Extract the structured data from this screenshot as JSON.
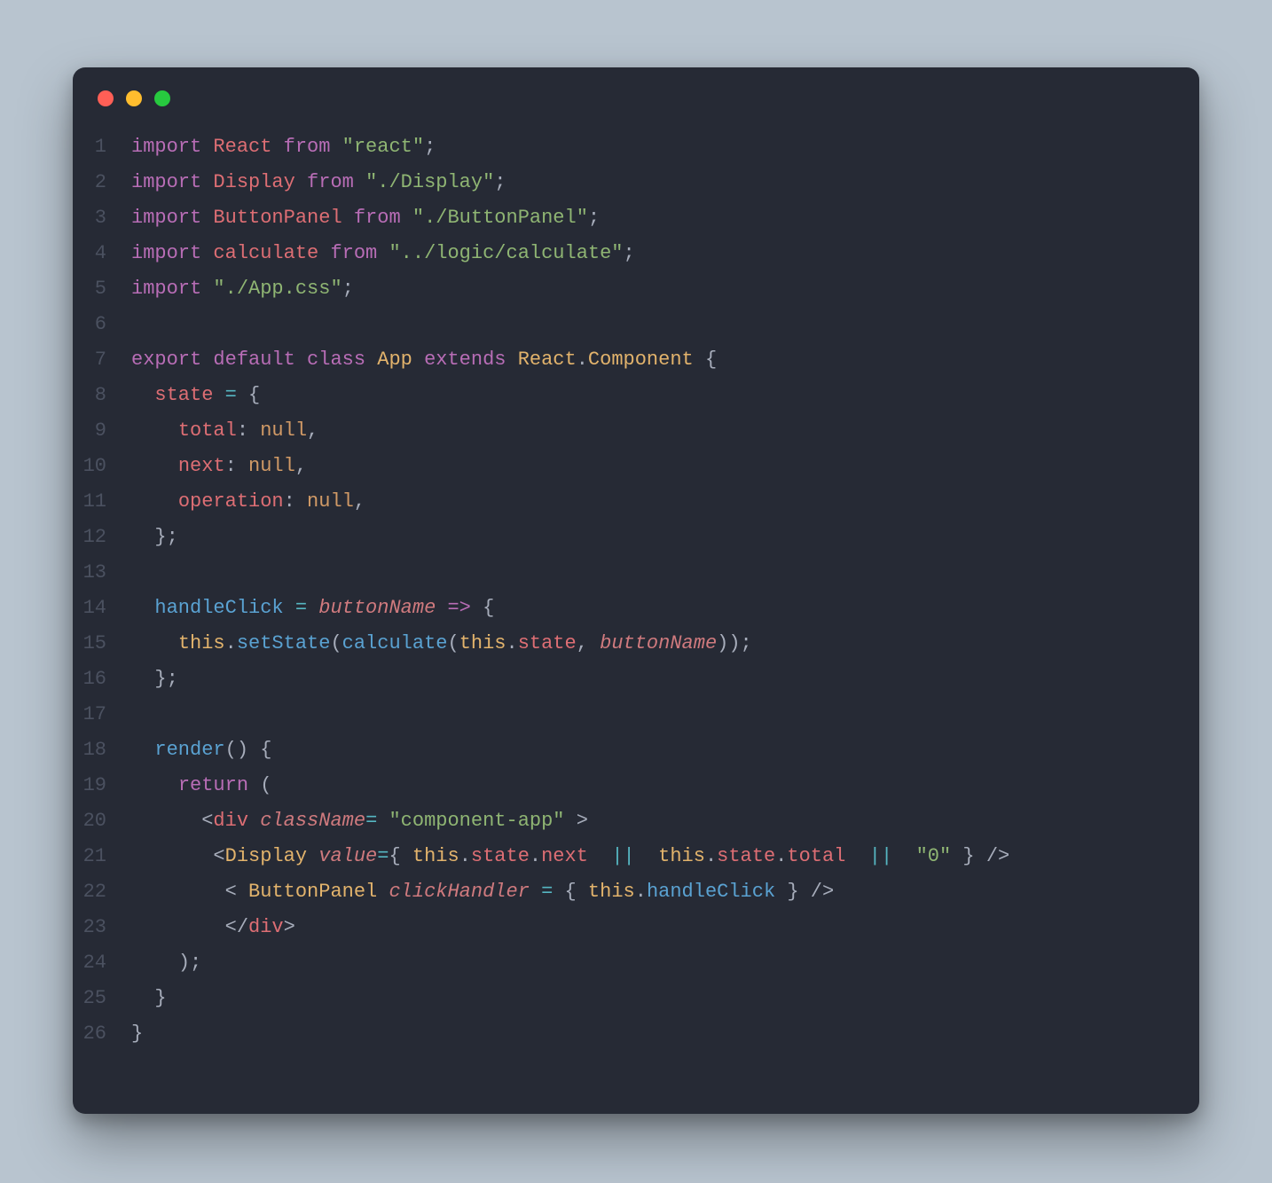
{
  "window": {
    "traffic_lights": [
      "red",
      "yellow",
      "green"
    ]
  },
  "code": {
    "lines": [
      {
        "n": 1,
        "tokens": [
          {
            "t": "import",
            "c": "keyword"
          },
          {
            "t": " "
          },
          {
            "t": "React",
            "c": "ident"
          },
          {
            "t": " "
          },
          {
            "t": "from",
            "c": "keyword"
          },
          {
            "t": " "
          },
          {
            "t": "\"react\"",
            "c": "str"
          },
          {
            "t": ";",
            "c": "punct"
          }
        ]
      },
      {
        "n": 2,
        "tokens": [
          {
            "t": "import",
            "c": "keyword"
          },
          {
            "t": " "
          },
          {
            "t": "Display",
            "c": "ident"
          },
          {
            "t": " "
          },
          {
            "t": "from",
            "c": "keyword"
          },
          {
            "t": " "
          },
          {
            "t": "\"./Display\"",
            "c": "str"
          },
          {
            "t": ";",
            "c": "punct"
          }
        ]
      },
      {
        "n": 3,
        "tokens": [
          {
            "t": "import",
            "c": "keyword"
          },
          {
            "t": " "
          },
          {
            "t": "ButtonPanel",
            "c": "ident"
          },
          {
            "t": " "
          },
          {
            "t": "from",
            "c": "keyword"
          },
          {
            "t": " "
          },
          {
            "t": "\"./ButtonPanel\"",
            "c": "str"
          },
          {
            "t": ";",
            "c": "punct"
          }
        ]
      },
      {
        "n": 4,
        "tokens": [
          {
            "t": "import",
            "c": "keyword"
          },
          {
            "t": " "
          },
          {
            "t": "calculate",
            "c": "ident"
          },
          {
            "t": " "
          },
          {
            "t": "from",
            "c": "keyword"
          },
          {
            "t": " "
          },
          {
            "t": "\"../logic/calculate\"",
            "c": "str"
          },
          {
            "t": ";",
            "c": "punct"
          }
        ]
      },
      {
        "n": 5,
        "tokens": [
          {
            "t": "import",
            "c": "keyword"
          },
          {
            "t": " "
          },
          {
            "t": "\"./App.css\"",
            "c": "str"
          },
          {
            "t": ";",
            "c": "punct"
          }
        ]
      },
      {
        "n": 6,
        "tokens": [
          {
            "t": " "
          }
        ]
      },
      {
        "n": 7,
        "tokens": [
          {
            "t": "export",
            "c": "keyword"
          },
          {
            "t": " "
          },
          {
            "t": "default",
            "c": "keyword"
          },
          {
            "t": " "
          },
          {
            "t": "class",
            "c": "keyword"
          },
          {
            "t": " "
          },
          {
            "t": "App",
            "c": "cls"
          },
          {
            "t": " "
          },
          {
            "t": "extends",
            "c": "keyword"
          },
          {
            "t": " "
          },
          {
            "t": "React",
            "c": "cls"
          },
          {
            "t": ".",
            "c": "punct"
          },
          {
            "t": "Component",
            "c": "cls"
          },
          {
            "t": " "
          },
          {
            "t": "{",
            "c": "punct"
          }
        ]
      },
      {
        "n": 8,
        "tokens": [
          {
            "t": "  "
          },
          {
            "t": "state",
            "c": "ident"
          },
          {
            "t": " "
          },
          {
            "t": "=",
            "c": "op"
          },
          {
            "t": " "
          },
          {
            "t": "{",
            "c": "punct"
          }
        ]
      },
      {
        "n": 9,
        "tokens": [
          {
            "t": "    "
          },
          {
            "t": "total",
            "c": "ident"
          },
          {
            "t": ":",
            "c": "punct"
          },
          {
            "t": " "
          },
          {
            "t": "null",
            "c": "builtin"
          },
          {
            "t": ",",
            "c": "punct"
          }
        ]
      },
      {
        "n": 10,
        "tokens": [
          {
            "t": "    "
          },
          {
            "t": "next",
            "c": "ident"
          },
          {
            "t": ":",
            "c": "punct"
          },
          {
            "t": " "
          },
          {
            "t": "null",
            "c": "builtin"
          },
          {
            "t": ",",
            "c": "punct"
          }
        ]
      },
      {
        "n": 11,
        "tokens": [
          {
            "t": "    "
          },
          {
            "t": "operation",
            "c": "ident"
          },
          {
            "t": ":",
            "c": "punct"
          },
          {
            "t": " "
          },
          {
            "t": "null",
            "c": "builtin"
          },
          {
            "t": ",",
            "c": "punct"
          }
        ]
      },
      {
        "n": 12,
        "tokens": [
          {
            "t": "  "
          },
          {
            "t": "};",
            "c": "punct"
          }
        ]
      },
      {
        "n": 13,
        "tokens": [
          {
            "t": " "
          }
        ]
      },
      {
        "n": 14,
        "tokens": [
          {
            "t": "  "
          },
          {
            "t": "handleClick",
            "c": "fn"
          },
          {
            "t": " "
          },
          {
            "t": "=",
            "c": "op"
          },
          {
            "t": " "
          },
          {
            "t": "buttonName",
            "c": "attr"
          },
          {
            "t": " "
          },
          {
            "t": "=>",
            "c": "keyword"
          },
          {
            "t": " "
          },
          {
            "t": "{",
            "c": "punct"
          }
        ]
      },
      {
        "n": 15,
        "tokens": [
          {
            "t": "    "
          },
          {
            "t": "this",
            "c": "cls"
          },
          {
            "t": ".",
            "c": "punct"
          },
          {
            "t": "setState",
            "c": "fn"
          },
          {
            "t": "(",
            "c": "punct"
          },
          {
            "t": "calculate",
            "c": "fn"
          },
          {
            "t": "(",
            "c": "punct"
          },
          {
            "t": "this",
            "c": "cls"
          },
          {
            "t": ".",
            "c": "punct"
          },
          {
            "t": "state",
            "c": "ident"
          },
          {
            "t": ", ",
            "c": "punct"
          },
          {
            "t": "buttonName",
            "c": "attr"
          },
          {
            "t": "));",
            "c": "punct"
          }
        ]
      },
      {
        "n": 16,
        "tokens": [
          {
            "t": "  "
          },
          {
            "t": "};",
            "c": "punct"
          }
        ]
      },
      {
        "n": 17,
        "tokens": [
          {
            "t": " "
          }
        ]
      },
      {
        "n": 18,
        "tokens": [
          {
            "t": "  "
          },
          {
            "t": "render",
            "c": "fn"
          },
          {
            "t": "()",
            "c": "punct"
          },
          {
            "t": " "
          },
          {
            "t": "{",
            "c": "punct"
          }
        ]
      },
      {
        "n": 19,
        "tokens": [
          {
            "t": "    "
          },
          {
            "t": "return",
            "c": "keyword"
          },
          {
            "t": " (",
            "c": "punct"
          }
        ]
      },
      {
        "n": 20,
        "tokens": [
          {
            "t": "      "
          },
          {
            "t": "<",
            "c": "punct"
          },
          {
            "t": "div",
            "c": "ident"
          },
          {
            "t": " "
          },
          {
            "t": "className",
            "c": "attr"
          },
          {
            "t": "=",
            "c": "op"
          },
          {
            "t": " "
          },
          {
            "t": "\"component-app\"",
            "c": "str"
          },
          {
            "t": " >",
            "c": "punct"
          }
        ]
      },
      {
        "n": 21,
        "tokens": [
          {
            "t": "       "
          },
          {
            "t": "<",
            "c": "punct"
          },
          {
            "t": "Display",
            "c": "cls"
          },
          {
            "t": " "
          },
          {
            "t": "value",
            "c": "attr"
          },
          {
            "t": "=",
            "c": "op"
          },
          {
            "t": "{ ",
            "c": "punct"
          },
          {
            "t": "this",
            "c": "cls"
          },
          {
            "t": ".",
            "c": "punct"
          },
          {
            "t": "state",
            "c": "ident"
          },
          {
            "t": ".",
            "c": "punct"
          },
          {
            "t": "next",
            "c": "ident"
          },
          {
            "t": "  "
          },
          {
            "t": "||",
            "c": "op"
          },
          {
            "t": "  "
          },
          {
            "t": "this",
            "c": "cls"
          },
          {
            "t": ".",
            "c": "punct"
          },
          {
            "t": "state",
            "c": "ident"
          },
          {
            "t": ".",
            "c": "punct"
          },
          {
            "t": "total",
            "c": "ident"
          },
          {
            "t": "  "
          },
          {
            "t": "||",
            "c": "op"
          },
          {
            "t": "  "
          },
          {
            "t": "\"0\"",
            "c": "str"
          },
          {
            "t": " } />",
            "c": "punct"
          }
        ]
      },
      {
        "n": 22,
        "tokens": [
          {
            "t": "        "
          },
          {
            "t": "< ",
            "c": "punct"
          },
          {
            "t": "ButtonPanel",
            "c": "cls"
          },
          {
            "t": " "
          },
          {
            "t": "clickHandler",
            "c": "attr"
          },
          {
            "t": " = ",
            "c": "op"
          },
          {
            "t": "{ ",
            "c": "punct"
          },
          {
            "t": "this",
            "c": "cls"
          },
          {
            "t": ".",
            "c": "punct"
          },
          {
            "t": "handleClick",
            "c": "fn"
          },
          {
            "t": " } />",
            "c": "punct"
          }
        ]
      },
      {
        "n": 23,
        "tokens": [
          {
            "t": "        "
          },
          {
            "t": "</",
            "c": "punct"
          },
          {
            "t": "div",
            "c": "ident"
          },
          {
            "t": ">",
            "c": "punct"
          }
        ]
      },
      {
        "n": 24,
        "tokens": [
          {
            "t": "    "
          },
          {
            "t": ");",
            "c": "punct"
          }
        ]
      },
      {
        "n": 25,
        "tokens": [
          {
            "t": "  "
          },
          {
            "t": "}",
            "c": "punct"
          }
        ]
      },
      {
        "n": 26,
        "tokens": [
          {
            "t": "}",
            "c": "punct"
          }
        ]
      }
    ]
  }
}
